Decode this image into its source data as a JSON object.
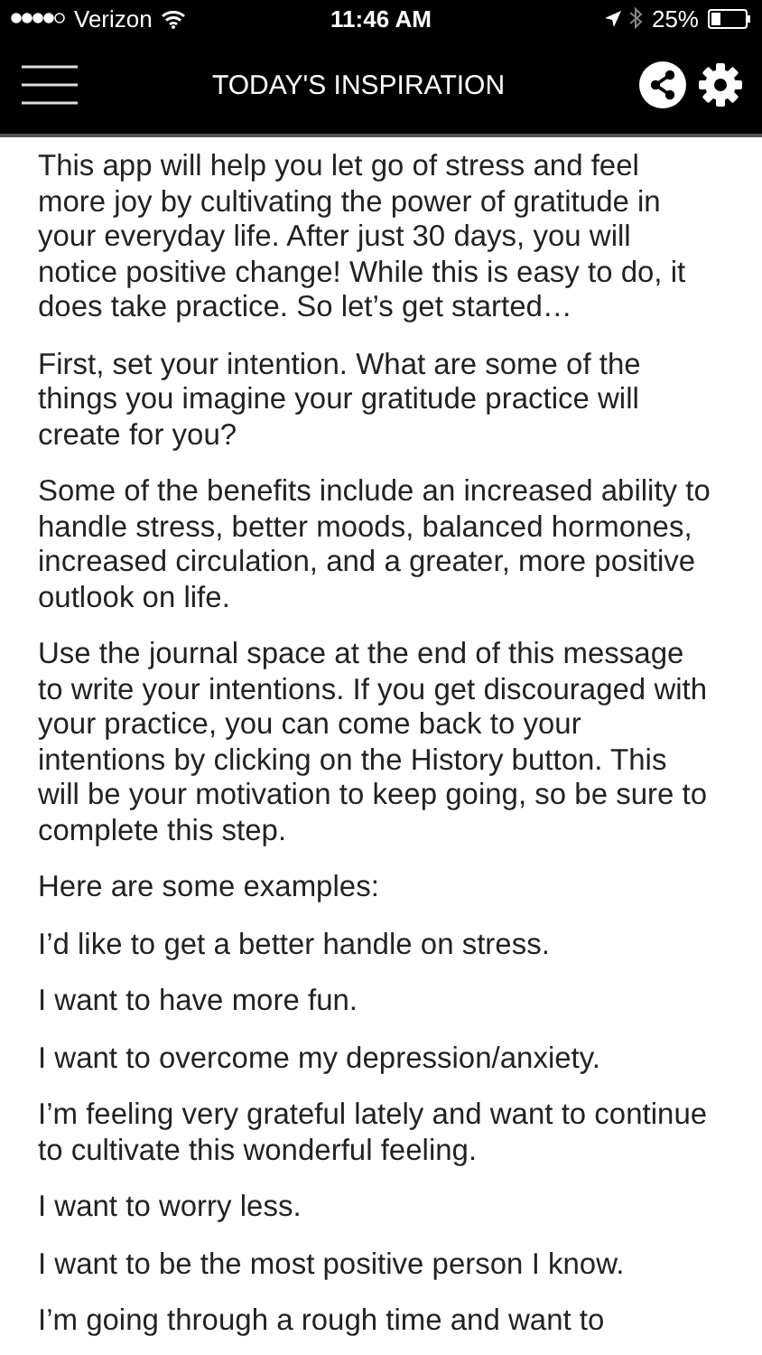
{
  "status_bar": {
    "carrier": "Verizon",
    "time": "11:46 AM",
    "battery": "25%"
  },
  "nav_bar": {
    "title": "TODAY'S INSPIRATION"
  },
  "paragraphs": [
    "This app will help you let go of stress and feel more joy by cultivating the power of gratitude in your everyday life. After just 30 days, you will notice positive change! While this is easy to do, it does take practice. So let’s get started…",
    "First, set your intention. What are some of the things you imagine your gratitude practice will create for you?",
    "Some of the benefits include an increased ability to handle stress, better moods, balanced hormones, increased circulation, and a greater, more positive outlook on life.",
    "Use the journal space at the end of this message to write your intentions. If you get discouraged with your practice, you can come back to your intentions by clicking on the History button. This will be your motivation to keep going, so be sure to complete this step.",
    "Here are some examples:",
    "I’d like to get a better handle on stress.",
    "I want to have more fun.",
    "I want to overcome my depression/anxiety.",
    "I’m feeling very grateful lately and want to continue to cultivate this wonderful feeling.",
    "I want to worry less.",
    "I want to be the most positive person I know.",
    "I’m going through a rough time and want to"
  ]
}
